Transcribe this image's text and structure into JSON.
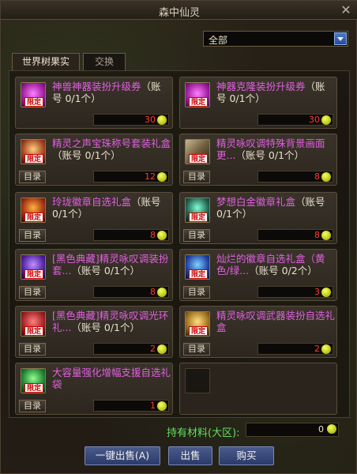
{
  "window": {
    "title": "森中仙灵",
    "close_glyph": "✕"
  },
  "filter": {
    "selected": "全部"
  },
  "tabs": [
    {
      "label": "世界树果实",
      "active": true
    },
    {
      "label": "交换",
      "active": false
    }
  ],
  "catalog_label": "目录",
  "limited_badge": "限定",
  "items": [
    {
      "name": "神兽神器装扮升级券",
      "account": "（账号 0/1个）",
      "price": "30",
      "has_catalog": false,
      "icon": "pink-orb-icon"
    },
    {
      "name": "神器克隆装扮升级券",
      "account": "（账号 0/1个）",
      "price": "30",
      "has_catalog": false,
      "icon": "pink-orb-icon"
    },
    {
      "name": "精灵之声宝珠称号套装礼盒",
      "account": "（账号 0/1个）",
      "price": "12",
      "has_catalog": true,
      "icon": "sparkle-box-icon"
    },
    {
      "name": "精灵咏叹调特殊背景画面更...",
      "account": "（账号 0/1个）",
      "price": "8",
      "has_catalog": true,
      "icon": "picture-frame-icon"
    },
    {
      "name": "玲珑徽章自选礼盒",
      "account": "（账号 0/1个）",
      "price": "8",
      "has_catalog": true,
      "icon": "fire-box-icon"
    },
    {
      "name": "梦想白金徽章礼盒",
      "account": "（账号 0/1个）",
      "price": "8",
      "has_catalog": true,
      "icon": "green-crystal-icon"
    },
    {
      "name": "[黑色典藏]精灵咏叹调装扮套...",
      "account": "（账号 0/1个）",
      "price": "8",
      "has_catalog": true,
      "icon": "purple-box-icon"
    },
    {
      "name": "灿烂的徽章自选礼盒（黄色/绿...",
      "account": "（账号 0/2个）",
      "price": "3",
      "has_catalog": true,
      "icon": "blue-crystal-icon"
    },
    {
      "name": "[黑色典藏]精灵咏叹调光环礼...",
      "account": "（账号 0/1个）",
      "price": "2",
      "has_catalog": true,
      "icon": "red-box-icon"
    },
    {
      "name": "精灵咏叹调武器装扮自选礼盒",
      "account": "",
      "price": "2",
      "has_catalog": true,
      "icon": "gold-box-icon"
    },
    {
      "name": "大容量强化增幅支援自选礼袋",
      "account": "",
      "price": "1",
      "has_catalog": true,
      "icon": "green-bag-icon"
    }
  ],
  "material": {
    "label": "持有材料(大区):",
    "value": "0"
  },
  "buttons": {
    "sell_all": "一键出售(A)",
    "sell": "出售",
    "buy": "购买"
  },
  "colors": {
    "item_name": "#e060e0",
    "price": "#ff3a3a",
    "material_label": "#60e060"
  }
}
